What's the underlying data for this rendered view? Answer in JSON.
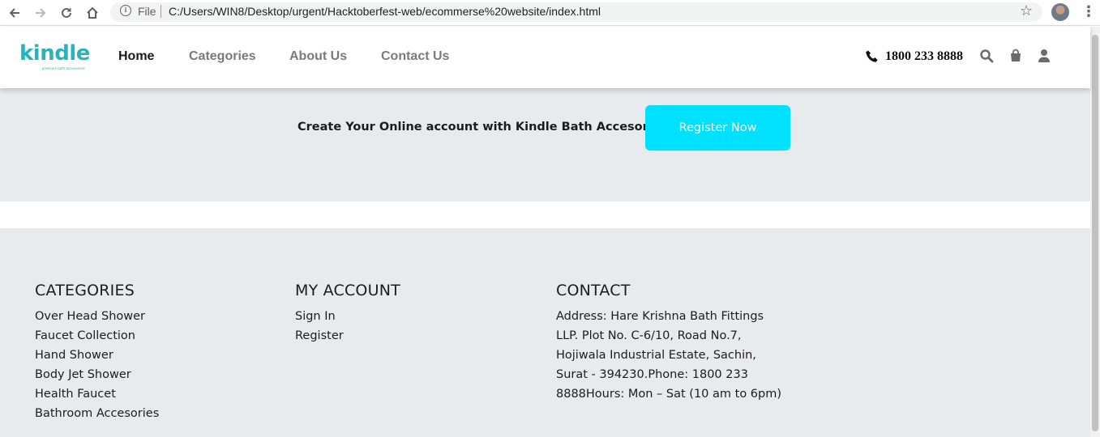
{
  "browser": {
    "scheme_label": "File",
    "url": "C:/Users/WIN8/Desktop/urgent/Hacktoberfest-web/ecommerse%20website/index.html",
    "back_icon": "arrow-left-icon",
    "forward_icon": "arrow-right-icon",
    "reload_icon": "reload-icon",
    "home_icon": "home-icon",
    "info_icon": "info-icon",
    "bookmark_icon": "star-icon",
    "menu_icon": "vertical-dots-icon"
  },
  "header": {
    "logo_text": "kindle",
    "logo_tagline": "premium bath accessories",
    "nav": [
      {
        "label": "Home",
        "active": true
      },
      {
        "label": "Categories",
        "active": false
      },
      {
        "label": "About Us",
        "active": false
      },
      {
        "label": "Contact Us",
        "active": false
      }
    ],
    "phone": "1800 233 8888",
    "icons": [
      "phone-icon",
      "search-icon",
      "shopping-bag-icon",
      "user-icon"
    ]
  },
  "register": {
    "text": "Create Your Online account with Kindle Bath Accesories",
    "button_label": "Register Now",
    "button_color": "#00e0ff"
  },
  "footer": {
    "categories": {
      "title": "CATEGORIES",
      "items": [
        "Over Head Shower",
        "Faucet Collection",
        "Hand Shower",
        "Body Jet Shower",
        "Health Faucet",
        "Bathroom Accesories"
      ]
    },
    "account": {
      "title": "MY ACCOUNT",
      "items": [
        "Sign In",
        "Register"
      ]
    },
    "contact": {
      "title": "CONTACT",
      "text": "Address: Hare Krishna Bath Fittings LLP. Plot No. C-6/10, Road No.7, Hojiwala Industrial Estate, Sachin, Surat - 394230.Phone: 1800 233 8888Hours: Mon – Sat (10 am to 6pm)"
    }
  },
  "colors": {
    "accent": "#00e0ff",
    "logo": "#26b5ba",
    "band_background": "#e8ebee"
  }
}
